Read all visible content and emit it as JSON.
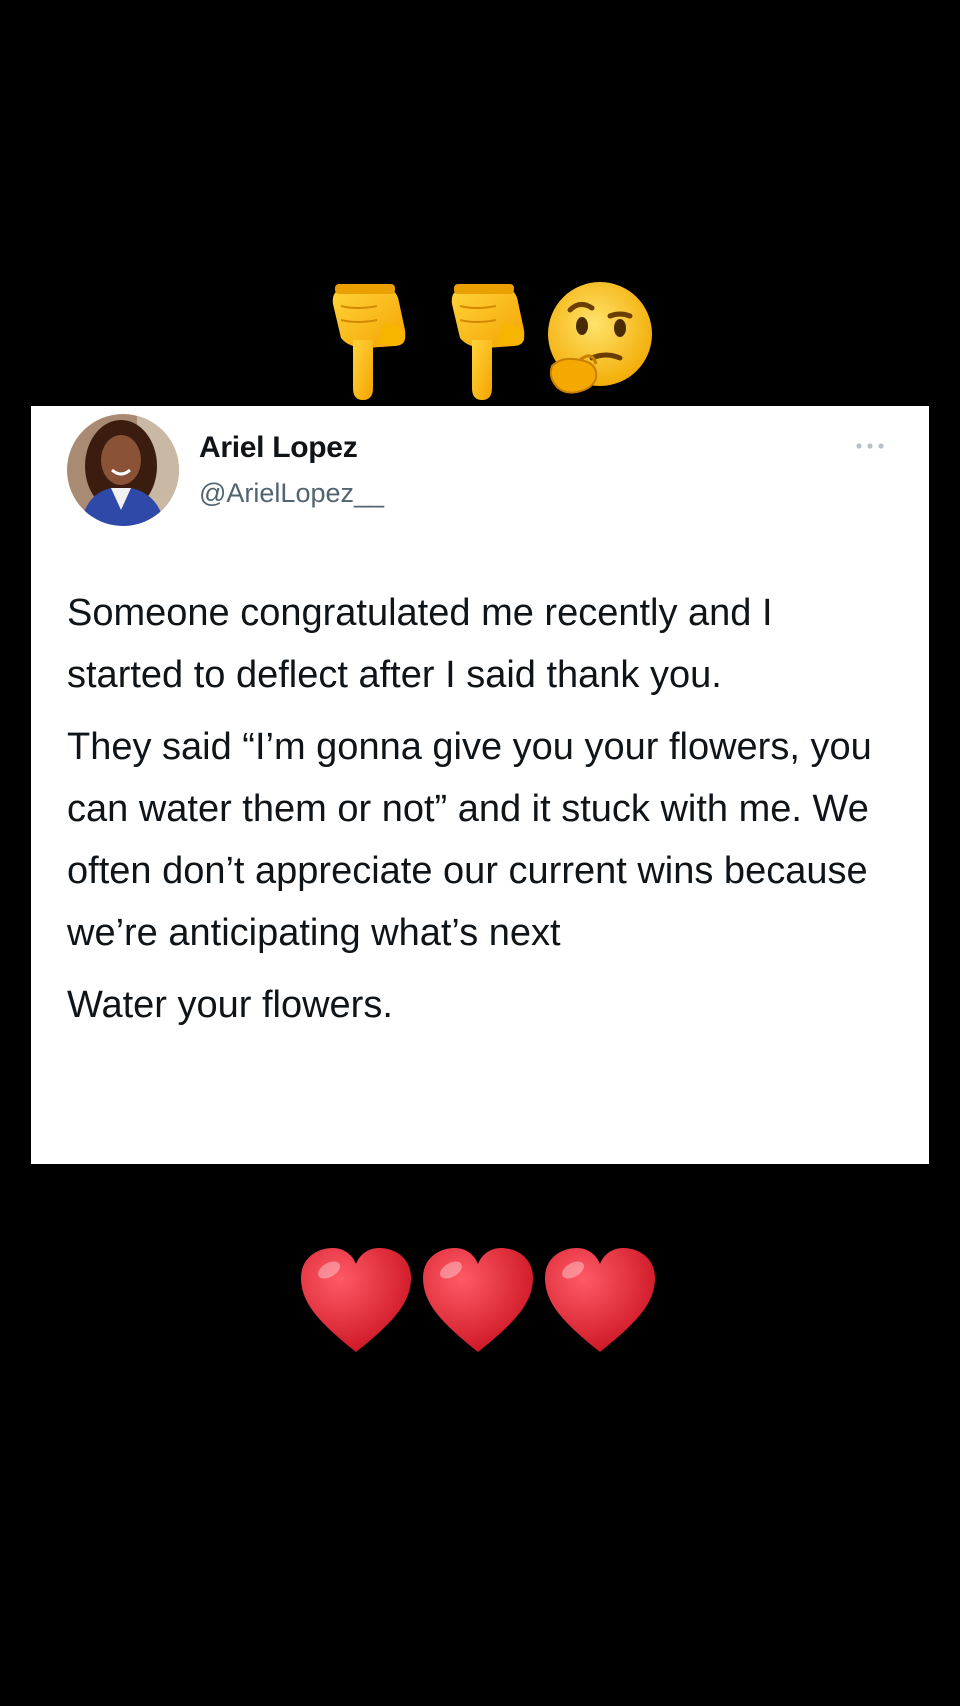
{
  "top_emojis": [
    {
      "icon": "pointing-down-hand-icon"
    },
    {
      "icon": "pointing-down-hand-icon"
    },
    {
      "icon": "thinking-face-icon"
    }
  ],
  "tweet": {
    "display_name": "Ariel Lopez",
    "handle": "@ArielLopez__",
    "avatar_icon": "profile-photo",
    "paragraphs": [
      "Someone congratulated me recently and I started to deflect after I said thank you.",
      "They said “I’m gonna give you your flowers, you can water them or not” and it stuck with me. We often don’t appreciate our current wins because we’re anticipating what’s next",
      "Water your flowers."
    ]
  },
  "hearts": [
    {
      "icon": "red-heart-icon",
      "color": "#e0182b"
    },
    {
      "icon": "red-heart-icon",
      "color": "#e0182b"
    },
    {
      "icon": "red-heart-icon",
      "color": "#e0182b"
    }
  ]
}
